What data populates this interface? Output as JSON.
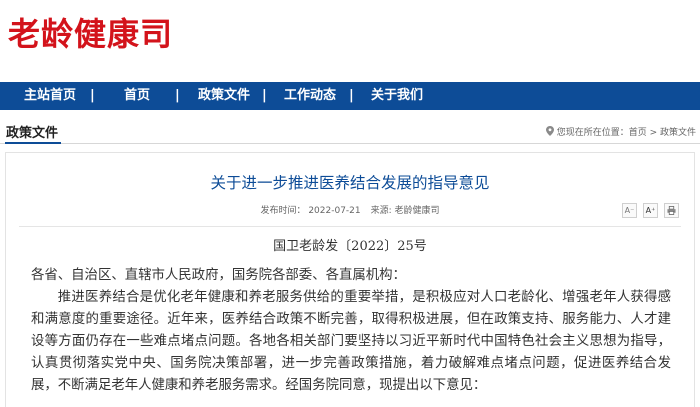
{
  "site": {
    "title": "老龄健康司"
  },
  "nav": {
    "items": [
      {
        "label": "主站首页"
      },
      {
        "label": "首页"
      },
      {
        "label": "政策文件"
      },
      {
        "label": "工作动态"
      },
      {
        "label": "关于我们"
      }
    ],
    "separator": "|"
  },
  "section": {
    "title": "政策文件",
    "breadcrumb": "您现在所在位置：首页 > 政策文件"
  },
  "article": {
    "title": "关于进一步推进医养结合发展的指导意见",
    "meta": {
      "date": "发布时间： 2022-07-21",
      "source": "来源: 老龄健康司"
    },
    "tools": {
      "decrease": "A⁻",
      "increase": "A⁺"
    },
    "doc_number": "国卫老龄发〔2022〕25号",
    "salutation": "各省、自治区、直辖市人民政府，国务院各部委、各直属机构：",
    "paragraph": "推进医养结合是优化老年健康和养老服务供给的重要举措，是积极应对人口老龄化、增强老年人获得感和满意度的重要途径。近年来，医养结合政策不断完善，取得积极进展，但在政策支持、服务能力、人才建设等方面仍存在一些难点堵点问题。各地各相关部门要坚持以习近平新时代中国特色社会主义思想为指导，认真贯彻落实党中央、国务院决策部署，进一步完善政策措施，着力破解难点堵点问题，促进医养结合发展，不断满足老年人健康和养老服务需求。经国务院同意，现提出以下意见："
  },
  "colors": {
    "brand_red": "#d3131b",
    "nav_blue": "#0d4c97",
    "title_blue": "#0d4c97"
  }
}
